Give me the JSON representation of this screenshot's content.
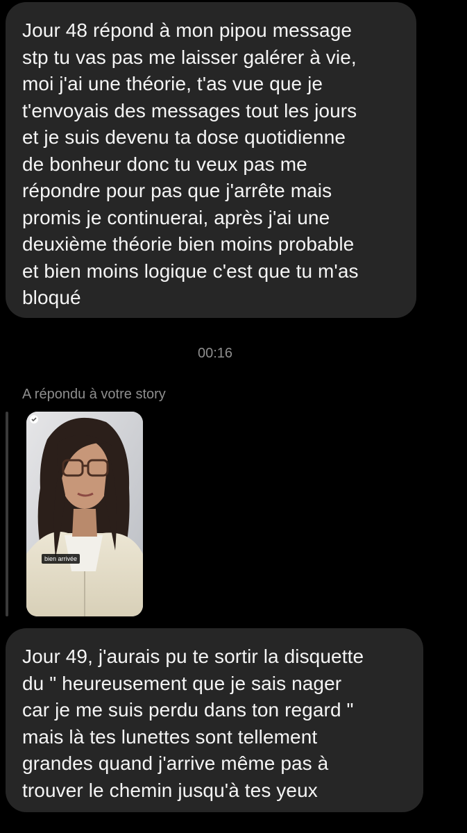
{
  "messages": [
    {
      "lines": [
        "Jour 48 répond à mon pipou message",
        "stp tu vas pas me laisser galérer à vie,",
        "moi j'ai une théorie, t'as vue que je",
        "t'envoyais des messages tout les jours",
        "et je suis devenu ta dose quotidienne",
        "de bonheur donc tu veux pas me",
        "répondre pour pas que j'arrête mais",
        "promis je continuerai, après j'ai une",
        "deuxième théorie bien moins probable",
        "et bien moins logique c'est que tu m'as",
        "bloqué"
      ]
    },
    {
      "lines": [
        "Jour 49, j'aurais pu te sortir la disquette",
        "du \" heureusement que je sais nager",
        "car je me suis perdu dans ton regard \"",
        "mais là tes lunettes sont tellement",
        "grandes quand j'arrive même pas à",
        "trouver le chemin jusqu'à tes yeux"
      ]
    }
  ],
  "timestamp": "00:16",
  "story_reply": {
    "label": "A répondu à votre story",
    "caption": "bien arrivée"
  },
  "colors": {
    "background": "#000000",
    "bubble": "#262626",
    "text": "#f5f5f5",
    "muted": "#8e8e8e"
  }
}
